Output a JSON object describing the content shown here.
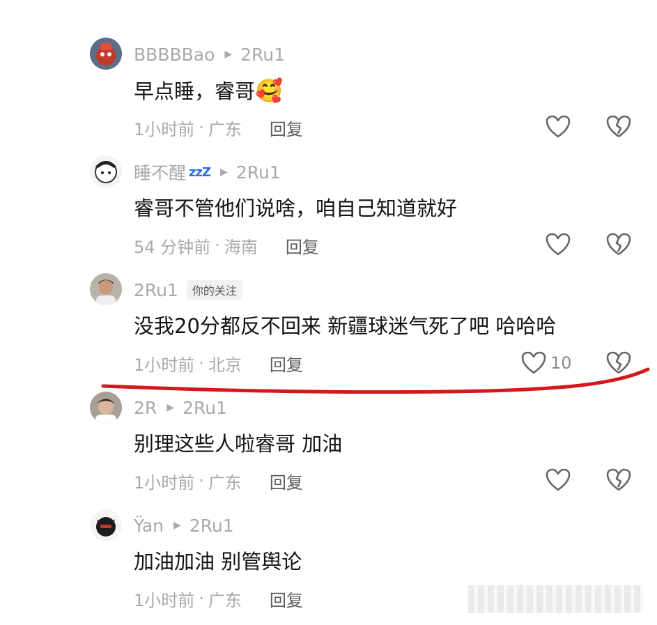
{
  "comments": [
    {
      "user": "BBBBBao",
      "reply_to": "2Ru1",
      "text": "早点睡，睿哥",
      "emoji": "🥰",
      "time": "1小时前",
      "location": "广东",
      "reply_label": "回复",
      "likes": ""
    },
    {
      "user": "睡不醒",
      "user_suffix": "zzZ",
      "reply_to": "2Ru1",
      "text": "睿哥不管他们说啥，咱自己知道就好",
      "time": "54 分钟前",
      "location": "海南",
      "reply_label": "回复",
      "likes": ""
    },
    {
      "user": "2Ru1",
      "tag": "你的关注",
      "text": "没我20分都反不回来 新疆球迷气死了吧 哈哈哈",
      "time": "1小时前",
      "location": "北京",
      "reply_label": "回复",
      "likes": "10"
    },
    {
      "user": "2R",
      "reply_to": "2Ru1",
      "text": "别理这些人啦睿哥 加油",
      "time": "1小时前",
      "location": "广东",
      "reply_label": "回复",
      "likes": ""
    },
    {
      "user": "Ÿan",
      "reply_to": "2Ru1",
      "text": "加油加油 别管舆论",
      "time": "1小时前",
      "location": "广东",
      "reply_label": "回复",
      "likes": ""
    }
  ],
  "separator": "·",
  "annotation_color": "#d3191c",
  "icons": {
    "like": "heart-outline-icon",
    "dislike": "broken-heart-icon",
    "reply_arrow": "triangle-right-icon"
  }
}
